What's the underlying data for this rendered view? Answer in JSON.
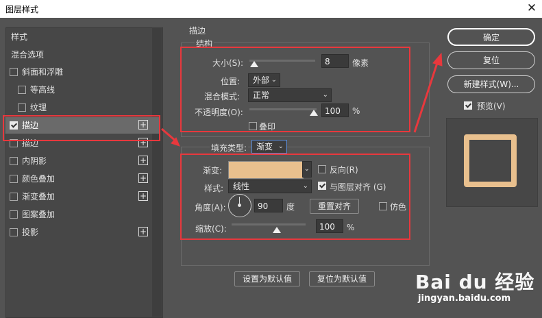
{
  "window": {
    "title": "图层样式",
    "close_glyph": "✕"
  },
  "left_panel": {
    "styles_label": "样式",
    "blend_options_label": "混合选项",
    "items": [
      {
        "label": "斜面和浮雕",
        "checked": false,
        "plus": false
      },
      {
        "label": "等高线",
        "checked": false,
        "plus": false
      },
      {
        "label": "纹理",
        "checked": false,
        "plus": false
      },
      {
        "label": "描边",
        "checked": true,
        "plus": true,
        "selected": true
      },
      {
        "label": "描边",
        "checked": false,
        "plus": true
      },
      {
        "label": "内阴影",
        "checked": false,
        "plus": true
      },
      {
        "label": "颜色叠加",
        "checked": false,
        "plus": true
      },
      {
        "label": "渐变叠加",
        "checked": false,
        "plus": true
      },
      {
        "label": "图案叠加",
        "checked": false,
        "plus": false
      },
      {
        "label": "投影",
        "checked": false,
        "plus": true
      }
    ],
    "plus_glyph": "+"
  },
  "stroke": {
    "section_title": "描边",
    "structure_title": "结构",
    "size_label": "大小(S):",
    "size_value": "8",
    "size_unit": "像素",
    "position_label": "位置:",
    "position_value": "外部",
    "blend_mode_label": "混合模式:",
    "blend_mode_value": "正常",
    "opacity_label": "不透明度(O):",
    "opacity_value": "100",
    "opacity_unit": "%",
    "overprint_label": "叠印",
    "fill_type_label": "填充类型:",
    "fill_type_value": "渐变",
    "gradient_label": "渐变:",
    "gradient_color": "#e9c08e",
    "reverse_label": "反向(R)",
    "style_label": "样式:",
    "style_value": "线性",
    "align_label": "与图层对齐 (G)",
    "angle_label": "角度(A):",
    "angle_value": "90",
    "angle_unit": "度",
    "reset_align_label": "重置对齐",
    "dither_label": "仿色",
    "scale_label": "缩放(C):",
    "scale_value": "100",
    "scale_unit": "%",
    "set_default_label": "设置为默认值",
    "reset_default_label": "复位为默认值"
  },
  "right": {
    "ok_label": "确定",
    "reset_label": "复位",
    "new_style_label": "新建样式(W)...",
    "preview_label": "预览(V)"
  },
  "watermark": {
    "brand": "Bai du 经验",
    "url": "jingyan.baidu.com"
  },
  "colors": {
    "highlight": "#e8383d",
    "accent_stroke": "#e9c08e"
  }
}
